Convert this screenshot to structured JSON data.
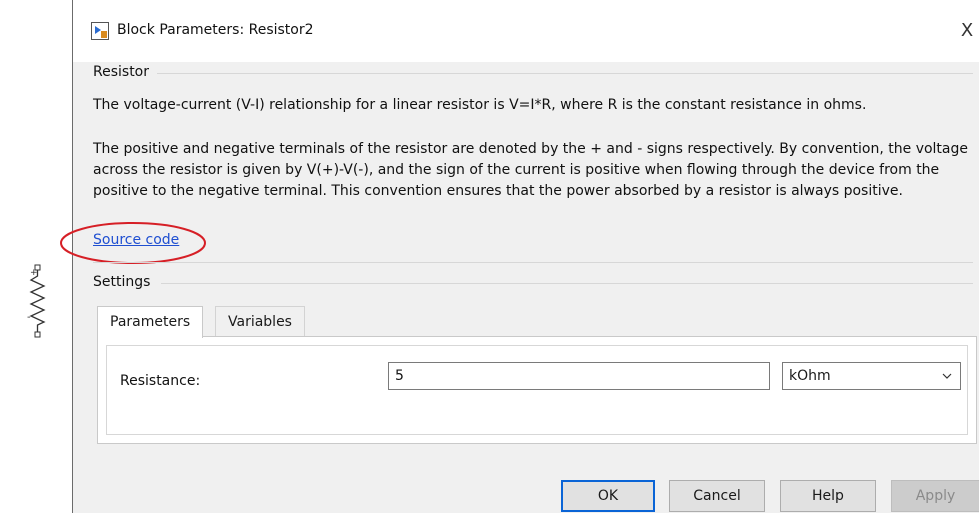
{
  "window": {
    "title": "Block Parameters: Resistor2",
    "close_glyph": "X",
    "icon": "simulink-block-icon"
  },
  "description": {
    "group_title": "Resistor",
    "paragraph1": "The voltage-current (V-I) relationship for a linear resistor is V=I*R, where R is the constant resistance in ohms.",
    "paragraph2": "The positive and negative terminals of the resistor are denoted by the + and - signs respectively. By convention, the voltage across the resistor is given by V(+)-V(-), and the sign of the current is positive when flowing through the device from the positive to the negative terminal. This convention ensures that the power absorbed by a resistor is always positive.",
    "link_label": "Source code"
  },
  "settings": {
    "group_title": "Settings",
    "tabs": [
      {
        "label": "Parameters",
        "active": true
      },
      {
        "label": "Variables",
        "active": false
      }
    ],
    "resistance": {
      "label": "Resistance:",
      "value": "5",
      "unit": "kOhm"
    }
  },
  "buttons": {
    "ok": "OK",
    "cancel": "Cancel",
    "help": "Help",
    "apply": "Apply"
  },
  "colors": {
    "annotation_ellipse": "#d61f26",
    "link": "#1f4fd1",
    "default_button_border": "#0a64d6"
  }
}
